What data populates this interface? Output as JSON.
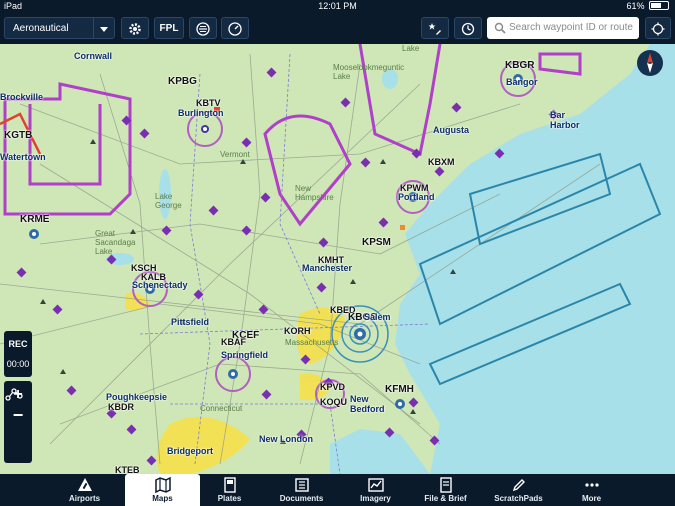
{
  "status_bar": {
    "device": "iPad",
    "time": "12:01 PM",
    "battery": "61%"
  },
  "toolbar": {
    "layer_selector": "Aeronautical",
    "fpl_label": "FPL",
    "search_placeholder": "Search waypoint ID or route"
  },
  "side_controls": {
    "rec_label": "REC",
    "timer": "00:00"
  },
  "map_labels": {
    "airports": [
      "KPBG",
      "KBTV",
      "KBGR",
      "KGTB",
      "KRME",
      "KPWM",
      "KBXM",
      "KPSM",
      "KMHT",
      "KSCH",
      "KALB",
      "KBED",
      "KBOS",
      "KORH",
      "KCEF",
      "KBAF",
      "KPVD",
      "KOQU",
      "KFMH",
      "KTEB",
      "KBDR"
    ],
    "cities": [
      "Cornwall",
      "Brockville",
      "Burlington",
      "Bangor",
      "Augusta",
      "Bar Harbor",
      "Portland",
      "Manchester",
      "Salem",
      "Pittsfield",
      "Springfield",
      "Poughkeepsie",
      "Bridgeport",
      "New London",
      "New Bedford",
      "Watertown",
      "Schenectady"
    ],
    "regions": [
      "Vermont",
      "New Hampshire",
      "Massachusetts",
      "Connecticut",
      "Lake George",
      "Great Sacandaga Lake",
      "Mooselookmeguntic Lake",
      "Lake"
    ]
  },
  "tabs": [
    {
      "label": "Airports",
      "active": false
    },
    {
      "label": "Maps",
      "active": true
    },
    {
      "label": "Plates",
      "active": false
    },
    {
      "label": "Documents",
      "active": false
    },
    {
      "label": "Imagery",
      "active": false
    },
    {
      "label": "File & Brief",
      "active": false
    },
    {
      "label": "ScratchPads",
      "active": false
    },
    {
      "label": "More",
      "active": false
    }
  ]
}
